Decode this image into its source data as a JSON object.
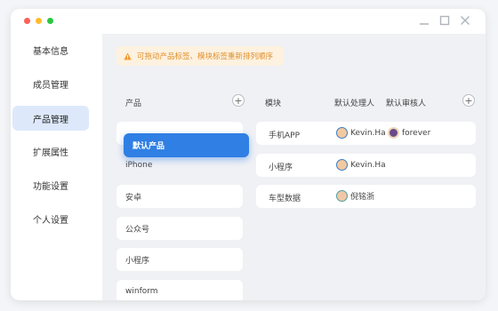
{
  "sidebar": {
    "items": [
      {
        "label": "基本信息",
        "active": false
      },
      {
        "label": "成员管理",
        "active": false
      },
      {
        "label": "产品管理",
        "active": true
      },
      {
        "label": "扩展属性",
        "active": false
      },
      {
        "label": "功能设置",
        "active": false
      },
      {
        "label": "个人设置",
        "active": false
      }
    ]
  },
  "notice": {
    "text": "可拖动产品标签、模块标签重新排列顺序"
  },
  "products": {
    "header": "产品",
    "dragging_label": "默认产品",
    "items": [
      "iPhone",
      "安卓",
      "公众号",
      "小程序",
      "winform"
    ]
  },
  "modules": {
    "header": "模块",
    "handler_header": "默认处理人",
    "reviewer_header": "默认审核人",
    "rows": [
      {
        "name": "手机APP",
        "handler": "Kevin.Ha",
        "reviewer": "forever"
      },
      {
        "name": "小程序",
        "handler": "Kevin.Ha",
        "reviewer": ""
      },
      {
        "name": "车型数据",
        "handler": "倪铭浙",
        "reviewer": ""
      }
    ]
  },
  "colors": {
    "accent": "#2f7fe4",
    "sidebar_active": "#dde9fb",
    "notice_bg": "#fdf1df",
    "notice_text": "#e0902a"
  }
}
